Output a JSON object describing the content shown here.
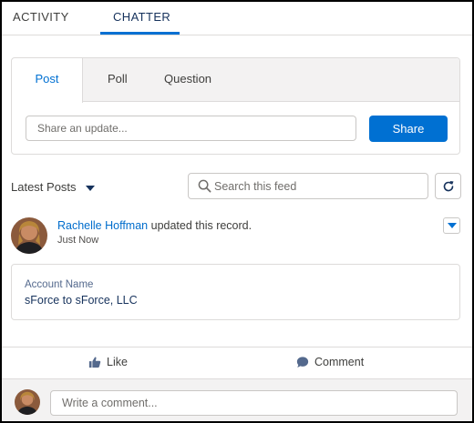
{
  "tabs": [
    {
      "label": "ACTIVITY",
      "active": false
    },
    {
      "label": "CHATTER",
      "active": true
    }
  ],
  "publisher": {
    "tabs": [
      {
        "label": "Post",
        "active": true
      },
      {
        "label": "Poll",
        "active": false
      },
      {
        "label": "Question",
        "active": false
      }
    ],
    "input_placeholder": "Share an update...",
    "share_label": "Share"
  },
  "feed": {
    "sort_label": "Latest Posts",
    "search_placeholder": "Search this feed"
  },
  "post": {
    "author": "Rachelle Hoffman",
    "action_text": " updated this record.",
    "time": "Just Now",
    "field_label": "Account Name",
    "field_value": "sForce to sForce, LLC",
    "like_label": "Like",
    "comment_label": "Comment"
  },
  "comment": {
    "placeholder": "Write a comment..."
  },
  "colors": {
    "accent": "#0070d2",
    "link": "#006dcc",
    "border": "#dddbda",
    "panel_bg": "#f3f2f2"
  },
  "icons": [
    "chevron-down-icon",
    "search-icon",
    "refresh-icon",
    "like-icon",
    "comment-icon",
    "avatar"
  ]
}
